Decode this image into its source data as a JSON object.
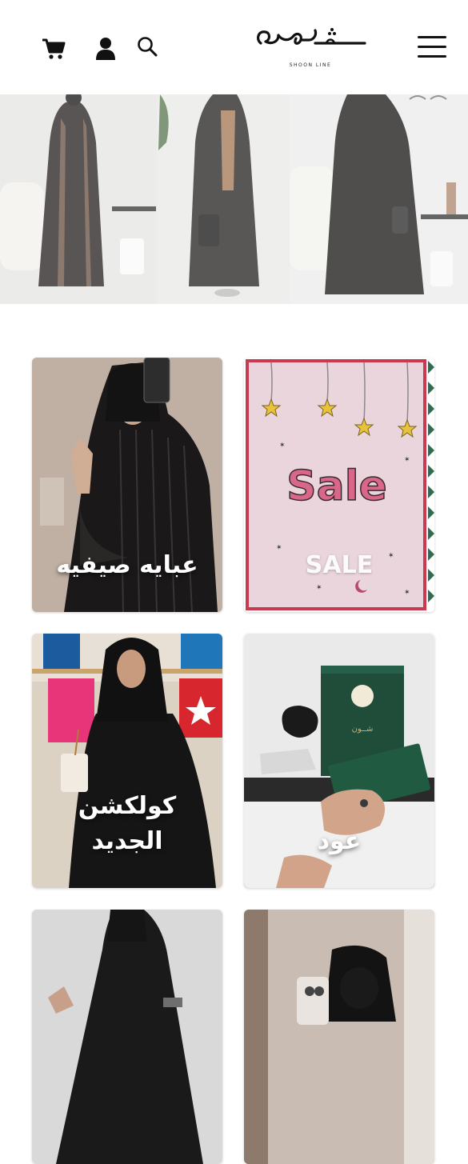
{
  "header": {
    "logo_text": "SHOON LINE",
    "icons": [
      "cart-icon",
      "user-icon",
      "search-icon",
      "menu-icon"
    ]
  },
  "hero": {
    "image": "banner of three black abayas"
  },
  "categories": [
    {
      "label": "عبايه صيفيه"
    },
    {
      "label": "SALE",
      "artwork_text": "Sale"
    },
    {
      "label_line1": "كولكشن",
      "label_line2": "الجديد"
    },
    {
      "label": "عود",
      "package_text": "شــون"
    },
    {
      "label": ""
    },
    {
      "label": ""
    }
  ],
  "colors": {
    "accent_pink": "#e8d1dc",
    "sale_text": "#d9678a",
    "green_box": "#1f4d3a"
  }
}
